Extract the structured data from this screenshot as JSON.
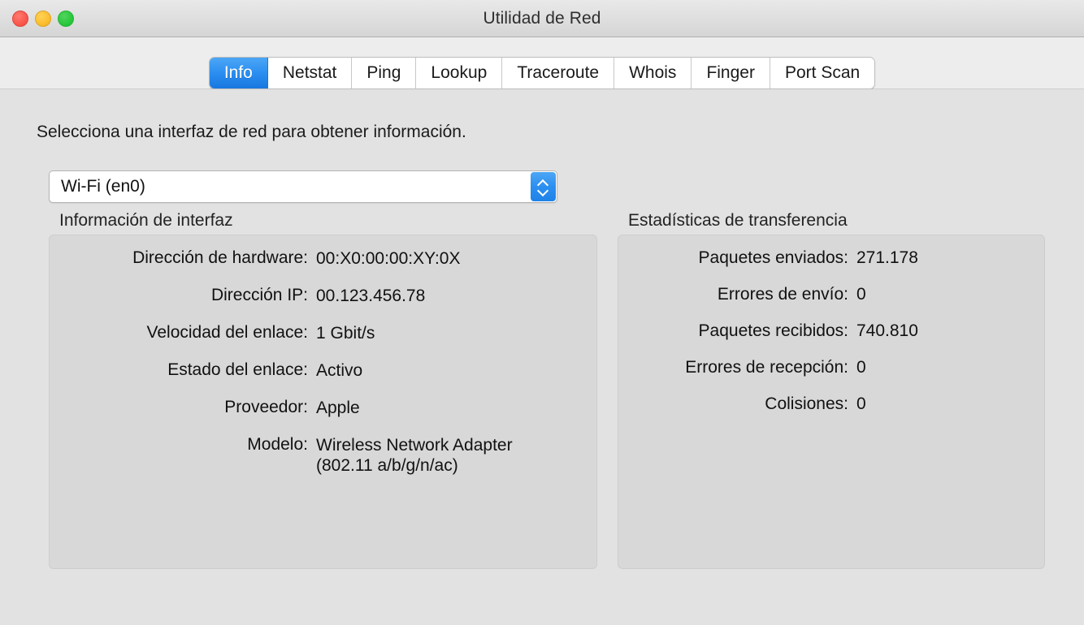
{
  "window": {
    "title": "Utilidad de Red",
    "controls": [
      {
        "name": "close-button",
        "label": ""
      },
      {
        "name": "minimize-button",
        "label": ""
      },
      {
        "name": "zoom-button",
        "label": ""
      }
    ]
  },
  "tabs": [
    {
      "label": "Info",
      "selected": true
    },
    {
      "label": "Netstat",
      "selected": false
    },
    {
      "label": "Ping",
      "selected": false
    },
    {
      "label": "Lookup",
      "selected": false
    },
    {
      "label": "Traceroute",
      "selected": false
    },
    {
      "label": "Whois",
      "selected": false
    },
    {
      "label": "Finger",
      "selected": false
    },
    {
      "label": "Port Scan",
      "selected": false
    }
  ],
  "main": {
    "hint": "Selecciona una interfaz de red para obtener información.",
    "interface_select": {
      "value": "Wi-Fi (en0)",
      "stepper_up_icon": "chevron-up-icon",
      "stepper_down_icon": "chevron-down-icon"
    },
    "interface_info": {
      "title": "Información de interfaz",
      "rows": [
        {
          "label": "Dirección de hardware:",
          "value": "00:X0:00:00:XY:0X"
        },
        {
          "label": "Dirección IP:",
          "value": "00.123.456.78"
        },
        {
          "label": "Velocidad del enlace:",
          "value": "1 Gbit/s"
        },
        {
          "label": "Estado del enlace:",
          "value": "Activo"
        },
        {
          "label": "Proveedor:",
          "value": "Apple"
        },
        {
          "label": "Modelo:",
          "value": "Wireless Network Adapter (802.11 a/b/g/n/ac)"
        }
      ]
    },
    "transfer_stats": {
      "title": "Estadísticas de transferencia",
      "rows": [
        {
          "label": "Paquetes enviados:",
          "value": "271.178"
        },
        {
          "label": "Errores de envío:",
          "value": "0"
        },
        {
          "label": "Paquetes recibidos:",
          "value": "740.810"
        },
        {
          "label": "Errores de recepción:",
          "value": "0"
        },
        {
          "label": "Colisiones:",
          "value": "0"
        }
      ]
    }
  },
  "colors": {
    "accent_blue": "#2b8ef0",
    "window_bg": "#e2e2e2",
    "tabstrip_bg": "#ededed",
    "groupbox_bg": "#d8d8d8",
    "close_red": "#f9564c",
    "minimize_yellow": "#fbbd2e",
    "zoom_green": "#28c83c"
  }
}
